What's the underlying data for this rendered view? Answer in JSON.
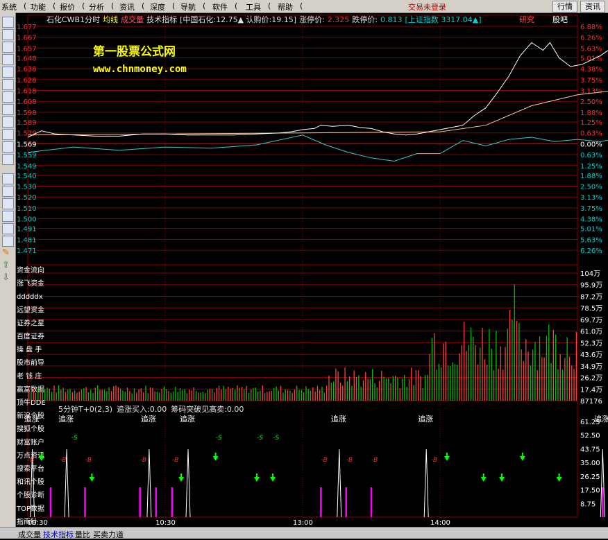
{
  "menubar": {
    "items": [
      "系统",
      "功能",
      "报价",
      "分析",
      "资讯",
      "深度",
      "导航",
      "软件",
      "工具",
      "帮助"
    ],
    "login": "交易未登录",
    "buttons": [
      "行情",
      "资讯"
    ]
  },
  "header": {
    "parts": [
      {
        "text": "石化CWB1分时",
        "color": "#e0e0e0"
      },
      {
        "text": "均线",
        "color": "#ffff00"
      },
      {
        "text": "成交量",
        "color": "#ff6060"
      },
      {
        "text": "技术指标",
        "color": "#e0e0e0"
      },
      {
        "text": "[中国石化:12.75▲ 认购价:19.15]",
        "color": "#e0e0e0"
      },
      {
        "text": "涨停价:",
        "color": "#e0e0e0"
      },
      {
        "text": "2.325",
        "color": "#ff3030"
      },
      {
        "text": "跌停价:",
        "color": "#e0e0e0"
      },
      {
        "text": "0.813",
        "color": "#00d0d0"
      },
      {
        "text": "[上证指数 3317.04▲]",
        "color": "#00d0d0"
      }
    ],
    "right": [
      {
        "text": "研究",
        "color": "#ff5050"
      },
      {
        "text": "股吧",
        "color": "#ffffff"
      }
    ]
  },
  "watermark": {
    "title": "第一股票公式网",
    "url": "www.chnmoney.com"
  },
  "colors": {
    "grid": "#8b0000",
    "up": "#ff3030",
    "down": "#00d0d0",
    "price": "#ffffff",
    "avg": "#ffcc99",
    "index": "#40c8c8",
    "ind_label": "#ff3030",
    "buy": "#00ff00",
    "pink": "#ff00ff",
    "volRed": "#ff4040",
    "volGreen": "#00c000"
  },
  "price_axis": {
    "left": [
      "1.677",
      "1.667",
      "1.657",
      "1.648",
      "1.638",
      "1.628",
      "1.618",
      "1.608",
      "1.598",
      "1.589",
      "1.579",
      "1.569",
      "1.559",
      "1.549",
      "1.540",
      "1.530",
      "1.520",
      "1.510",
      "1.500",
      "1.491",
      "1.481",
      "1.471"
    ],
    "right": [
      "6.88%",
      "6.26%",
      "5.63%",
      "5.01%",
      "4.38%",
      "3.75%",
      "3.13%",
      "2.50%",
      "1.88%",
      "1.25%",
      "0.63%",
      "0.00%",
      "0.63%",
      "1.25%",
      "1.88%",
      "2.50%",
      "3.13%",
      "3.75%",
      "4.38%",
      "5.01%",
      "5.63%",
      "6.26%"
    ],
    "base": "1.569"
  },
  "volume_axis": {
    "right": [
      "104万",
      "95.9万",
      "87.2万",
      "78.5万",
      "69.7万",
      "61.0万",
      "52.3万",
      "43.6万",
      "34.9万",
      "26.2万",
      "17.4万",
      "87176"
    ]
  },
  "side_links": [
    "资金流向",
    "涨飞资金",
    "dddddx",
    "远望资金",
    "证券之星",
    "百度证券",
    "操 盘 手",
    "股市前导",
    "老 钱 庄",
    "赢富数据",
    "顶牛DDE",
    "新浪个股",
    "搜狐个股",
    "财富账户",
    "万点资讯",
    "搜索平台",
    "和讯个股",
    "个股诊断",
    "TOP数据",
    "指南针"
  ],
  "indicator": {
    "header": [
      {
        "text": "5分钟T+0(2,3)",
        "color": "#e0e0e0"
      },
      {
        "text": "追涨买入:0.00",
        "color": "#e0e0e0"
      },
      {
        "text": "筹码突破见高卖:0.00",
        "color": "#e0e0e0"
      }
    ],
    "axis": [
      "61.25",
      "52.50",
      "43.75",
      "35.00",
      "26.25",
      "17.50",
      "8.75"
    ],
    "signal_text": "追涨",
    "buy_mark": "B",
    "sell_mark": "S"
  },
  "time_axis": [
    "09:30",
    "10:30",
    "13:00",
    "14:00"
  ],
  "bottom_tabs": [
    "成交量",
    "技术指标",
    "量比",
    "买卖力道"
  ],
  "chart_data": {
    "type": "line",
    "title": "石化CWB1分时",
    "x_session_minutes": 240,
    "price": {
      "base": 1.569,
      "points": [
        [
          0,
          1.575
        ],
        [
          6,
          1.581
        ],
        [
          12,
          1.578
        ],
        [
          20,
          1.577
        ],
        [
          30,
          1.576
        ],
        [
          40,
          1.576
        ],
        [
          50,
          1.578
        ],
        [
          60,
          1.578
        ],
        [
          70,
          1.577
        ],
        [
          80,
          1.577
        ],
        [
          90,
          1.577
        ],
        [
          100,
          1.578
        ],
        [
          110,
          1.579
        ],
        [
          115,
          1.58
        ],
        [
          120,
          1.582
        ],
        [
          125,
          1.583
        ],
        [
          128,
          1.586
        ],
        [
          133,
          1.585
        ],
        [
          140,
          1.586
        ],
        [
          145,
          1.584
        ],
        [
          150,
          1.583
        ],
        [
          155,
          1.58
        ],
        [
          160,
          1.578
        ],
        [
          165,
          1.577
        ],
        [
          170,
          1.578
        ],
        [
          175,
          1.58
        ],
        [
          180,
          1.582
        ],
        [
          185,
          1.584
        ],
        [
          190,
          1.586
        ],
        [
          195,
          1.595
        ],
        [
          200,
          1.602
        ],
        [
          205,
          1.616
        ],
        [
          210,
          1.631
        ],
        [
          215,
          1.65
        ],
        [
          220,
          1.662
        ],
        [
          225,
          1.655
        ],
        [
          228,
          1.662
        ],
        [
          232,
          1.648
        ],
        [
          237,
          1.64
        ],
        [
          242,
          1.642
        ],
        [
          250,
          1.65
        ],
        [
          257,
          1.66
        ],
        [
          262,
          1.648
        ],
        [
          268,
          1.658
        ],
        [
          275,
          1.654
        ],
        [
          282,
          1.665
        ],
        [
          290,
          1.655
        ],
        [
          296,
          1.662
        ],
        [
          300,
          1.655
        ]
      ]
    },
    "avg": {
      "points": [
        [
          0,
          1.577
        ],
        [
          60,
          1.578
        ],
        [
          120,
          1.579
        ],
        [
          180,
          1.58
        ],
        [
          200,
          1.586
        ],
        [
          220,
          1.604
        ],
        [
          240,
          1.614
        ],
        [
          260,
          1.619
        ],
        [
          280,
          1.623
        ],
        [
          300,
          1.626
        ]
      ]
    },
    "index": {
      "points": [
        [
          0,
          1.561
        ],
        [
          20,
          1.566
        ],
        [
          40,
          1.563
        ],
        [
          60,
          1.566
        ],
        [
          80,
          1.565
        ],
        [
          100,
          1.568
        ],
        [
          120,
          1.577
        ],
        [
          130,
          1.568
        ],
        [
          140,
          1.561
        ],
        [
          150,
          1.556
        ],
        [
          160,
          1.553
        ],
        [
          170,
          1.56
        ],
        [
          180,
          1.56
        ],
        [
          190,
          1.572
        ],
        [
          200,
          1.567
        ],
        [
          210,
          1.573
        ],
        [
          220,
          1.575
        ],
        [
          230,
          1.571
        ],
        [
          240,
          1.573
        ],
        [
          250,
          1.571
        ],
        [
          260,
          1.575
        ],
        [
          270,
          1.576
        ],
        [
          280,
          1.575
        ],
        [
          300,
          1.578
        ]
      ]
    },
    "volume_range": [
      0,
      1040000
    ],
    "indicator_range": [
      0,
      70
    ],
    "signals": {
      "zhuizhang": [
        2,
        17,
        53,
        70,
        136,
        174,
        251,
        278
      ],
      "sell": [
        19,
        82,
        100,
        107
      ],
      "buy_arrows": [
        6,
        28,
        67,
        82,
        100,
        107,
        183,
        199,
        207,
        216,
        232
      ],
      "pink_bars": [
        10,
        25,
        49,
        56,
        63,
        128,
        139,
        150,
        251,
        273
      ]
    }
  }
}
